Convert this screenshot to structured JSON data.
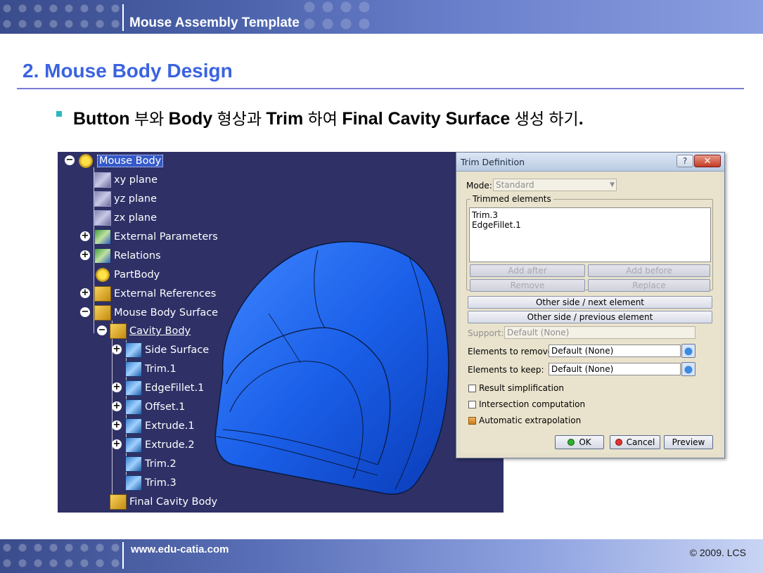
{
  "header": {
    "title": "Mouse Assembly Template"
  },
  "section": {
    "title": "2. Mouse Body Design"
  },
  "bullet": {
    "p1": "Button",
    "p2": " 부와 ",
    "p3": "Body",
    "p4": " 형상과 ",
    "p5": "Trim",
    "p6": " 하여 ",
    "p7": "Final Cavity Surface",
    "p8": " 생성 하기",
    "p9": "."
  },
  "tree": {
    "root": "Mouse Body",
    "items": [
      {
        "label": "xy plane"
      },
      {
        "label": "yz plane"
      },
      {
        "label": "zx plane"
      },
      {
        "label": "External Parameters"
      },
      {
        "label": "Relations"
      },
      {
        "label": "PartBody"
      },
      {
        "label": "External References"
      },
      {
        "label": "Mouse Body Surface"
      },
      {
        "label": "Cavity Body"
      },
      {
        "label": "Side Surface"
      },
      {
        "label": "Trim.1"
      },
      {
        "label": "EdgeFillet.1"
      },
      {
        "label": "Offset.1"
      },
      {
        "label": "Extrude.1"
      },
      {
        "label": "Extrude.2"
      },
      {
        "label": "Trim.2"
      },
      {
        "label": "Trim.3"
      },
      {
        "label": "Final Cavity Body"
      }
    ],
    "expand_plus": "+",
    "expand_minus": "−"
  },
  "dialog": {
    "title": "Trim Definition",
    "help": "?",
    "close": "✕",
    "mode_label": "Mode:",
    "mode_value": "Standard",
    "trimmed_label": "Trimmed elements",
    "trimmed_items": [
      "Trim.3",
      "EdgeFillet.1"
    ],
    "add_after": "Add after",
    "add_before": "Add before",
    "remove": "Remove",
    "replace": "Replace",
    "other_next": "Other side / next element",
    "other_prev": "Other side / previous element",
    "support_label": "Support:",
    "support_value": "Default (None)",
    "remove_label": "Elements to remove:",
    "remove_value": "Default (None)",
    "keep_label": "Elements to keep:",
    "keep_value": "Default (None)",
    "result_simplification": "Result simplification",
    "intersection_computation": "Intersection computation",
    "automatic_extrapolation": "Automatic extrapolation",
    "ok": "OK",
    "cancel": "Cancel",
    "preview": "Preview"
  },
  "footer": {
    "url": "www.edu-catia.com",
    "copyright": "© 2009. LCS"
  },
  "colors": {
    "title_blue": "#3a63e0",
    "viewport_bg": "#2e3066",
    "mouse_blue": "#1a5fe8"
  }
}
